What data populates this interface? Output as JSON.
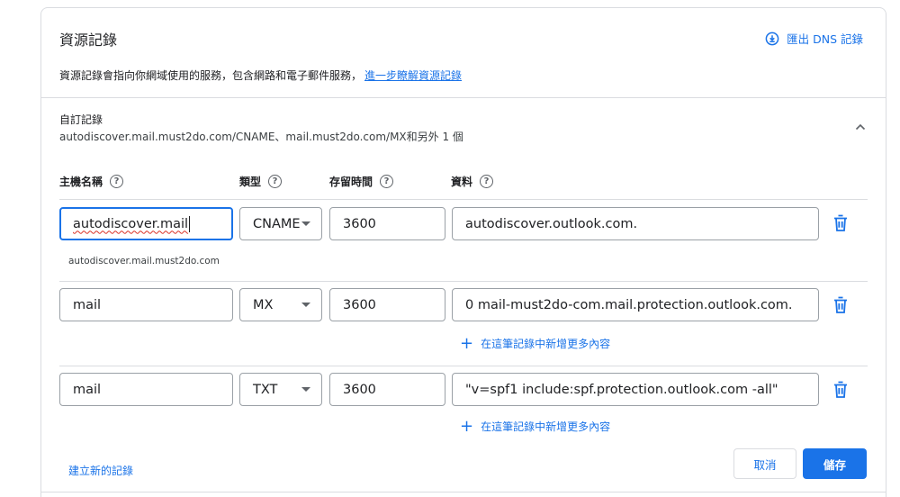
{
  "header": {
    "title": "資源記錄",
    "export_label": "匯出 DNS 記錄",
    "description": "資源記錄會指向你網域使用的服務，包含網路和電子郵件服務，",
    "learn_more": "進一步瞭解資源記錄"
  },
  "section": {
    "title": "自訂記錄",
    "summary": "autodiscover.mail.must2do.com/CNAME、mail.must2do.com/MX和另外 1 個"
  },
  "columns": {
    "host": "主機名稱",
    "type": "類型",
    "ttl": "存留時間",
    "data": "資料",
    "help_glyph": "?"
  },
  "records": [
    {
      "host": "autodiscover.mail",
      "type": "CNAME",
      "ttl": "3600",
      "data": "autodiscover.outlook.com.",
      "hint": "autodiscover.mail.must2do.com"
    },
    {
      "host": "mail",
      "type": "MX",
      "ttl": "3600",
      "data": "0 mail-must2do-com.mail.protection.outlook.com.",
      "add_more": "在這筆記錄中新增更多內容"
    },
    {
      "host": "mail",
      "type": "TXT",
      "ttl": "3600",
      "data": "\"v=spf1 include:spf.protection.outlook.com -all\"",
      "add_more": "在這筆記錄中新增更多內容"
    }
  ],
  "footer": {
    "new_record": "建立新的記錄",
    "cancel": "取消",
    "save": "儲存"
  },
  "colors": {
    "accent": "#1a73e8",
    "border": "#dadce0",
    "spell_error": "#d93025"
  },
  "icons": {
    "export": "download-circle-icon",
    "collapse": "chevron-up-icon",
    "delete": "trash-icon",
    "add": "plus-icon",
    "help": "help-circle-icon",
    "dropdown": "dropdown-arrow-icon"
  }
}
